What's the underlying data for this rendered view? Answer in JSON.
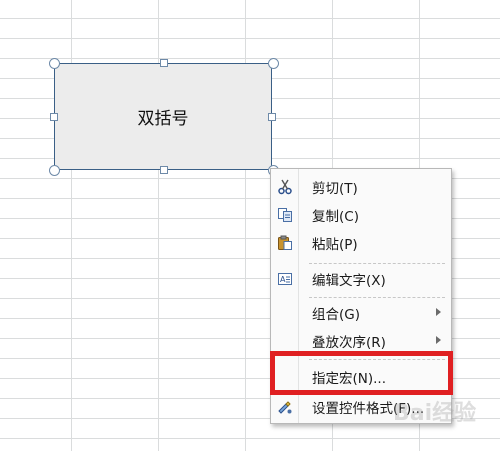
{
  "shape": {
    "text": "双括号"
  },
  "context_menu": {
    "items": [
      {
        "label": "剪切(T)",
        "icon": "scissors-icon"
      },
      {
        "label": "复制(C)",
        "icon": "copy-icon"
      },
      {
        "label": "粘贴(P)",
        "icon": "paste-icon"
      },
      {
        "label": "编辑文字(X)",
        "icon": "edit-text-icon"
      },
      {
        "label": "组合(G)",
        "icon": "",
        "submenu": true
      },
      {
        "label": "叠放次序(R)",
        "icon": "",
        "submenu": true
      },
      {
        "label": "指定宏(N)...",
        "icon": ""
      },
      {
        "label": "设置控件格式(F)...",
        "icon": "format-control-icon"
      }
    ]
  },
  "highlight_color": "#e02022",
  "watermark": "Bai经验"
}
